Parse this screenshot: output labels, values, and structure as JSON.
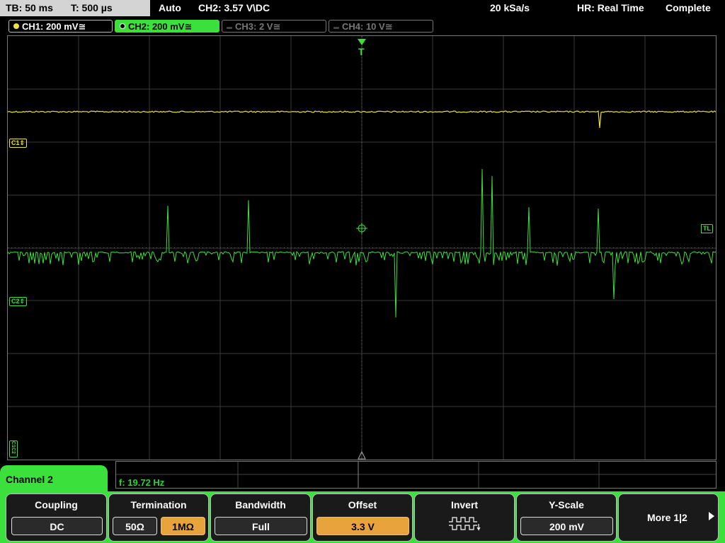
{
  "status_bar": {
    "timebase": "TB: 50 ms",
    "trigger_time": "T: 500 µs",
    "trigger_mode": "Auto",
    "trigger_source": "CH2: 3.57 V",
    "trigger_edge_coupling": "\\DC",
    "sample_rate": "20 kSa/s",
    "acq_mode": "HR: Real Time",
    "acq_state": "Complete"
  },
  "channel_tabs": [
    {
      "label": "CH1: 200 mV",
      "suffix": "≅",
      "color": "#f0e03c",
      "active": false,
      "enabled": true
    },
    {
      "label": "CH2: 200 mV",
      "suffix": "≅",
      "color": "#3ce03c",
      "active": true,
      "enabled": true
    },
    {
      "label": "CH3: 2 V",
      "suffix": "≅",
      "color": "#777777",
      "active": false,
      "enabled": false
    },
    {
      "label": "CH4: 10 V",
      "suffix": "≅",
      "color": "#777777",
      "active": false,
      "enabled": false
    }
  ],
  "screen_markers": {
    "trigger_position": "T",
    "ch1_offset": "C1",
    "ch2_offset": "C2",
    "trigger_level": "TL",
    "bottom_left": "C1C2"
  },
  "measurement": {
    "frequency": "f: 19.72 Hz"
  },
  "menu": {
    "title": "Channel 2",
    "softkeys": {
      "coupling": {
        "title": "Coupling",
        "value": "DC"
      },
      "termination": {
        "title": "Termination",
        "options": [
          "50Ω",
          "1MΩ"
        ],
        "selected": "1MΩ"
      },
      "bandwidth": {
        "title": "Bandwidth",
        "value": "Full"
      },
      "offset": {
        "title": "Offset",
        "value": "3.3 V"
      },
      "invert": {
        "title": "Invert"
      },
      "y_scale": {
        "title": "Y-Scale",
        "value": "200 mV"
      },
      "more": {
        "label": "More 1|2"
      }
    }
  },
  "colors": {
    "ch1": "#f0e03c",
    "ch2": "#3ce03c",
    "grid": "#3a3a3a",
    "menu_bg": "#3ce03c",
    "highlight": "#e8a33c"
  }
}
